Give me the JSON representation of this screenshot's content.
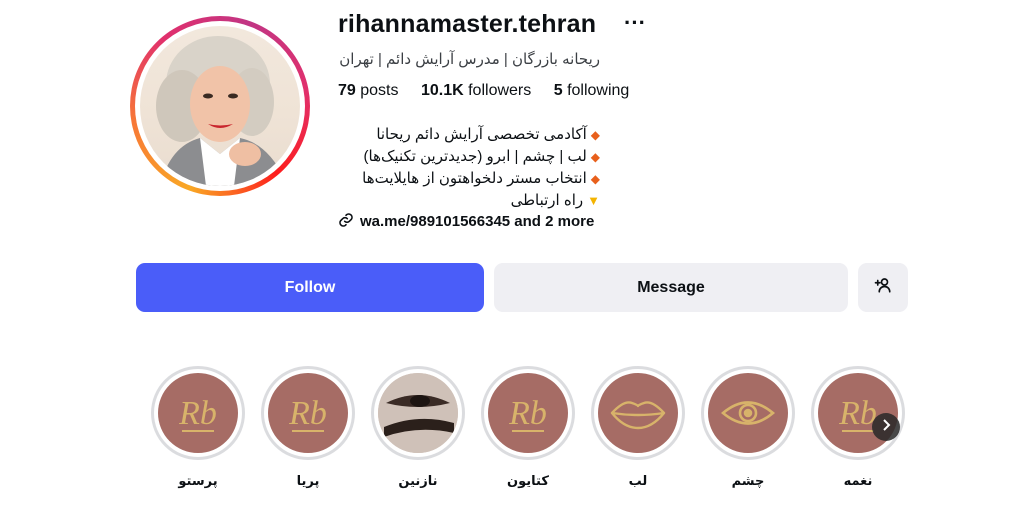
{
  "profile": {
    "username": "rihannamaster.tehran",
    "full_name": "ریحانه بازرگان | مدرس آرایش دائم | تهران",
    "stats": {
      "posts_count": "79",
      "posts_label": "posts",
      "followers_count": "10.1K",
      "followers_label": "followers",
      "following_count": "5",
      "following_label": "following"
    },
    "bio": [
      "آکادمی تخصصی آرایش دائم ریحانا",
      "لب | چشم | ابرو (جدیدترین تکنیک‌ها)",
      "انتخاب مستر دلخواهتون از هایلایت‌ها",
      "راه ارتباطی"
    ],
    "link_text": "wa.me/989101566345 and 2 more"
  },
  "actions": {
    "follow_label": "Follow",
    "message_label": "Message"
  },
  "highlights": [
    {
      "label": "پرستو",
      "cover": "rb-logo"
    },
    {
      "label": "پریا",
      "cover": "rb-logo"
    },
    {
      "label": "نازنین",
      "cover": "eyeliner-photo"
    },
    {
      "label": "کتایون",
      "cover": "rb-logo"
    },
    {
      "label": "لب",
      "cover": "lips-icon"
    },
    {
      "label": "چشم",
      "cover": "eye-icon"
    },
    {
      "label": "نغمه",
      "cover": "rb-logo"
    }
  ],
  "colors": {
    "follow_button": "#4a5df9",
    "secondary_button": "#efeff3",
    "highlight_cover": "#a66c65",
    "gold": "#d8b36a"
  }
}
